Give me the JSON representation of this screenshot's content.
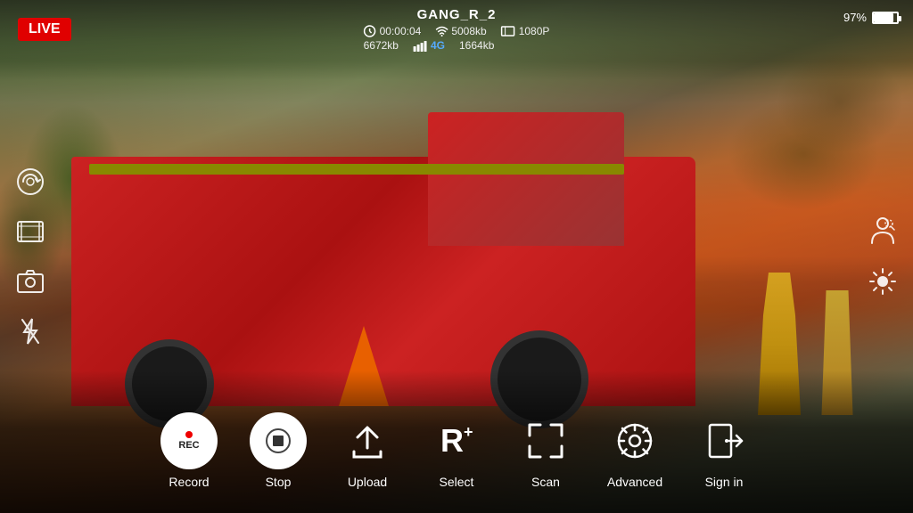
{
  "live_badge": "LIVE",
  "channel": {
    "name": "GANG_R_2"
  },
  "stats": {
    "time": "00:00:04",
    "wifi_kb": "5008kb",
    "resolution": "1080P",
    "data_kb": "6672kb",
    "network": "4G",
    "network_kb": "1664kb"
  },
  "battery_percent": "97%",
  "left_icons": [
    {
      "name": "camera-rotate-icon",
      "symbol": "⟳📷"
    },
    {
      "name": "video-icon",
      "symbol": "🎞"
    },
    {
      "name": "photo-icon",
      "symbol": "📷"
    },
    {
      "name": "flash-off-icon",
      "symbol": "⚡"
    }
  ],
  "right_icons": [
    {
      "name": "person-detect-icon",
      "symbol": "👤"
    },
    {
      "name": "brightness-icon",
      "symbol": "☀"
    }
  ],
  "toolbar": {
    "items": [
      {
        "id": "record",
        "label": "Record",
        "icon_type": "record"
      },
      {
        "id": "stop",
        "label": "Stop",
        "icon_type": "stop"
      },
      {
        "id": "upload",
        "label": "Upload",
        "icon_type": "upload"
      },
      {
        "id": "select",
        "label": "Select",
        "icon_type": "select"
      },
      {
        "id": "scan",
        "label": "Scan",
        "icon_type": "scan"
      },
      {
        "id": "advanced",
        "label": "Advanced",
        "icon_type": "gear"
      },
      {
        "id": "signin",
        "label": "Sign in",
        "icon_type": "signin"
      }
    ]
  }
}
